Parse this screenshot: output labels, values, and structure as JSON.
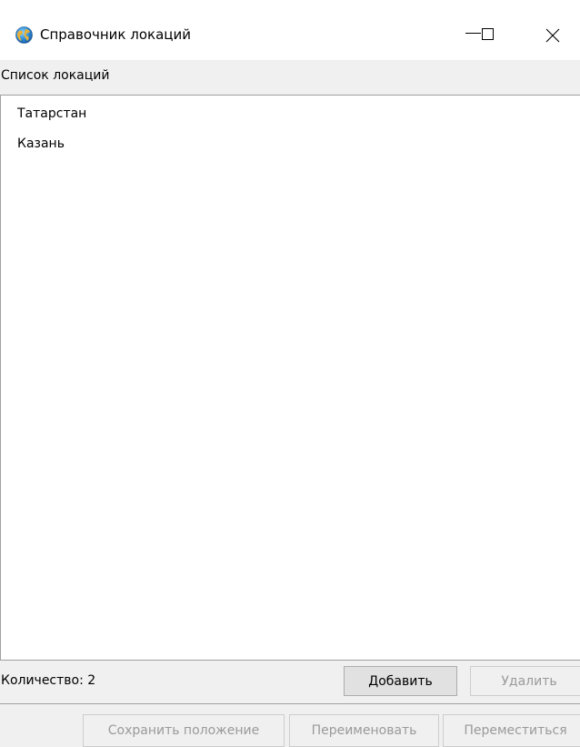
{
  "window": {
    "title": "Справочник локаций",
    "icon": "globe-icon",
    "controls": {
      "minimize": "minimize-icon",
      "maximize": "maximize-icon",
      "close": "close-icon"
    }
  },
  "locations": {
    "label": "Список локаций",
    "items": [
      "Татарстан",
      "Казань"
    ]
  },
  "footer": {
    "count_text": "Количество: 2",
    "add_label": "Добавить",
    "delete_label": "Удалить",
    "save_position_label": "Сохранить положение",
    "rename_label": "Переименовать",
    "move_label": "Переместиться"
  },
  "colors": {
    "window_bg": "#f0f0f0",
    "titlebar_bg": "#ffffff",
    "list_bg": "#ffffff",
    "disabled_text": "#9a9a9a"
  }
}
